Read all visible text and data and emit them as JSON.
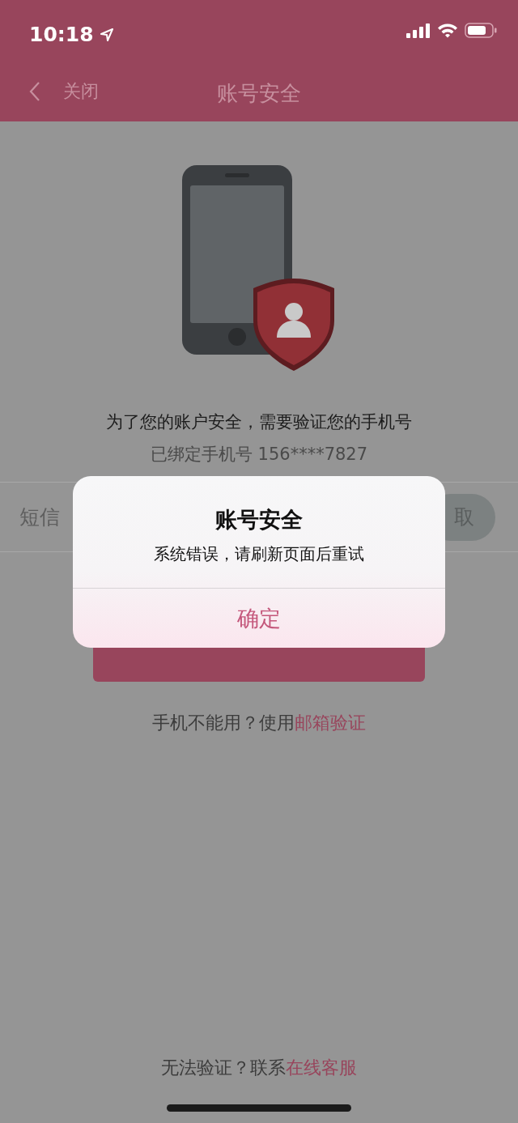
{
  "status_bar": {
    "time": "10:18"
  },
  "nav": {
    "back_label": "关闭",
    "title": "账号安全"
  },
  "intro": {
    "message": "为了您的账户安全，需要验证您的手机号",
    "bound_phone": "已绑定手机号 156****7827"
  },
  "code_field": {
    "placeholder": "短信",
    "get_code_label": "取"
  },
  "help_line": {
    "text": "手机不能用？使用",
    "link": "邮箱验证"
  },
  "footer": {
    "text": "无法验证？联系",
    "link": "在线客服"
  },
  "dialog": {
    "title": "账号安全",
    "message": "系统错误，请刷新页面后重试",
    "buttons": [
      "确定"
    ]
  }
}
